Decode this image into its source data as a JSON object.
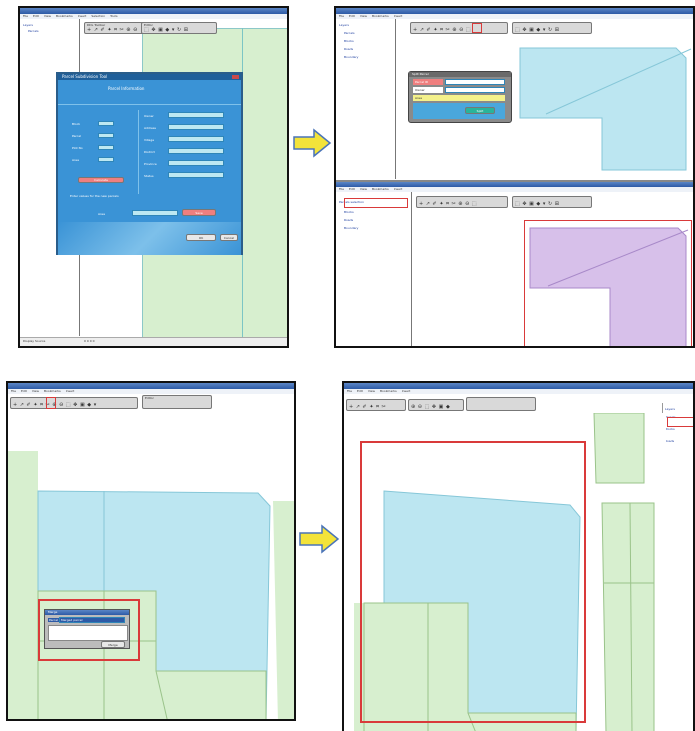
{
  "panels": {
    "top_left": {
      "menu": [
        "File",
        "Edit",
        "View",
        "Bookmarks",
        "Insert",
        "Selection",
        "Tools",
        "Windows",
        "Help"
      ],
      "toolbar1_caption": "DDL Toolbar",
      "toolbar2_caption": "Editor",
      "toolbar_icons": "+ ↗ ✐ ✦ ⌗ ✂ ⊕ ⊖",
      "toolbar_icons2": "⬚ ✥ ▣ ◆ ▾ ↻ ⊞",
      "toc_layers": "Layers",
      "toc_item": "Parcels",
      "status_tabs": "Display  Source",
      "status_coords": "0  0  0  0",
      "dialog": {
        "title": "Parcel Subdivision Tool",
        "heading": "Parcel Information",
        "left_fields": [
          "Block",
          "Parcel",
          "Plot No",
          "Area"
        ],
        "right_fields": [
          "Owner",
          "Address",
          "Village",
          "District",
          "Province",
          "Status"
        ],
        "calc_button": "Calculate",
        "note": "Enter values for the new parcels",
        "bottom_label": "Area",
        "save_button": "Save",
        "ok_button": "OK",
        "cancel_button": "Cancel"
      }
    },
    "top_right": {
      "menu": [
        "File",
        "Edit",
        "View",
        "Bookmarks",
        "Insert",
        "Selection",
        "Tools",
        "Windows",
        "Help"
      ],
      "toolbar_icons": "+ ↗ ✐ ✦ ⌗ ✂ ⊕ ⊖ ⬚",
      "toolbar_icons2": "⬚ ✥ ▣ ◆ ▾ ↻ ⊞",
      "toc_items": [
        "Layers",
        "Parcels",
        "Blocks",
        "Roads",
        "Boundary"
      ],
      "dialog": {
        "title": "Split Parcel",
        "row1": "Parcel ID",
        "row2": "Owner",
        "row3": "Area",
        "button": "Split"
      },
      "lower_menu": [
        "File",
        "Edit",
        "View",
        "Bookmarks",
        "Insert"
      ],
      "lower_toc_items": [
        "Parcels selection",
        "Blocks",
        "Roads",
        "Boundary"
      ]
    },
    "bottom_left": {
      "menu": [
        "File",
        "Edit",
        "View",
        "Bookmarks",
        "Insert",
        "Selection",
        "Tools",
        "Windows",
        "Help"
      ],
      "toolbar_icons": "+ ↗ ✐ ✦ ⌗ ✂ ⊕ ⊖ ⬚ ✥ ▣ ◆ ▾",
      "toolbar2_caption": "Editor",
      "dialog": {
        "title": "Merge",
        "label": "Parcel",
        "value": "Merged parcel",
        "button": "Merge"
      }
    },
    "bottom_right": {
      "menu": [
        "File",
        "Edit",
        "View",
        "Bookmarks",
        "Insert",
        "Selection",
        "Tools",
        "Windows",
        "Help"
      ],
      "toolbar_icons": "+ ↗ ✐ ✦ ⌗ ✂",
      "toolbar_icons2": "⊕ ⊖ ⬚ ✥ ▣ ◆",
      "toc_items": [
        "Layers",
        "Parcels",
        "Blocks",
        "Roads"
      ]
    }
  },
  "colors": {
    "parcel_blue": "#bce6f1",
    "parcel_green": "#d7efcf",
    "parcel_purple": "#d7c0ea",
    "highlight_red": "#d93a3a",
    "arrow_yellow": "#f3e33a",
    "dialog_blue": "#2f8fd0"
  }
}
